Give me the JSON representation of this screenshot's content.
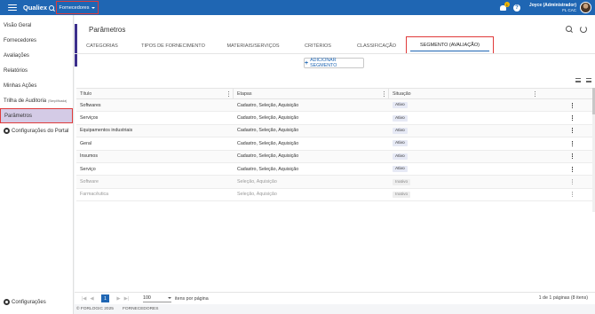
{
  "topbar": {
    "brand": "Qualiex",
    "module": "Fornecedores",
    "notification_count": "1",
    "help": "?",
    "user_name": "Joyce (Administrador)",
    "user_role": "FL CAC"
  },
  "sidebar": {
    "items": [
      {
        "label": "Visão Geral"
      },
      {
        "label": "Fornecedores"
      },
      {
        "label": "Avaliações"
      },
      {
        "label": "Relatórios"
      },
      {
        "label": "Minhas Ações"
      },
      {
        "label": "Trilha de Auditoria",
        "note": "(Simplificada)"
      },
      {
        "label": "Parâmetros"
      },
      {
        "label": "Configurações do Portal"
      }
    ],
    "bottom": "Configurações"
  },
  "main": {
    "title": "Parâmetros",
    "tabs": [
      {
        "label": "Categorias"
      },
      {
        "label": "Tipos de Fornecimento"
      },
      {
        "label": "Materiais/Serviços"
      },
      {
        "label": "Critérios"
      },
      {
        "label": "Classificação"
      },
      {
        "label": "Segmento (Avaliação)"
      }
    ],
    "add_button": "ADICIONAR SEGMENTO"
  },
  "table": {
    "headers": [
      "Título",
      "Etapas",
      "Situação"
    ],
    "rows": [
      {
        "title": "Softwares",
        "steps": "Cadastro, Seleção, Aquisição",
        "status": "Ativo",
        "inactive": false
      },
      {
        "title": "Serviços",
        "steps": "Cadastro, Seleção, Aquisição",
        "status": "Ativo",
        "inactive": false
      },
      {
        "title": "Equipamentos industriais",
        "steps": "Cadastro, Seleção, Aquisição",
        "status": "Ativo",
        "inactive": false
      },
      {
        "title": "Geral",
        "steps": "Cadastro, Seleção, Aquisição",
        "status": "Ativo",
        "inactive": false
      },
      {
        "title": "Insumos",
        "steps": "Cadastro, Seleção, Aquisição",
        "status": "Ativo",
        "inactive": false
      },
      {
        "title": "Serviço",
        "steps": "Cadastro, Seleção, Aquisição",
        "status": "Ativo",
        "inactive": false
      },
      {
        "title": "Software",
        "steps": "Seleção, Aquisição",
        "status": "Inativo",
        "inactive": true
      },
      {
        "title": "Farmacêutica",
        "steps": "Seleção, Aquisição",
        "status": "Inativo",
        "inactive": true
      }
    ]
  },
  "pager": {
    "first": "|◀",
    "prev": "◀",
    "current_page": "1",
    "next": "▶",
    "last": "▶|",
    "per_page": "100",
    "per_page_label": "itens por página",
    "range": "1 de 1 páginas (8 itens)"
  },
  "footer": {
    "copyright": "© FORLOGIC 2025",
    "module": "FORNECEDORES"
  },
  "colors": {
    "primary": "#1f66b3",
    "highlight": "#e03a3a",
    "active_nav": "#d4cbe6",
    "accent": "#3c2f8c"
  }
}
